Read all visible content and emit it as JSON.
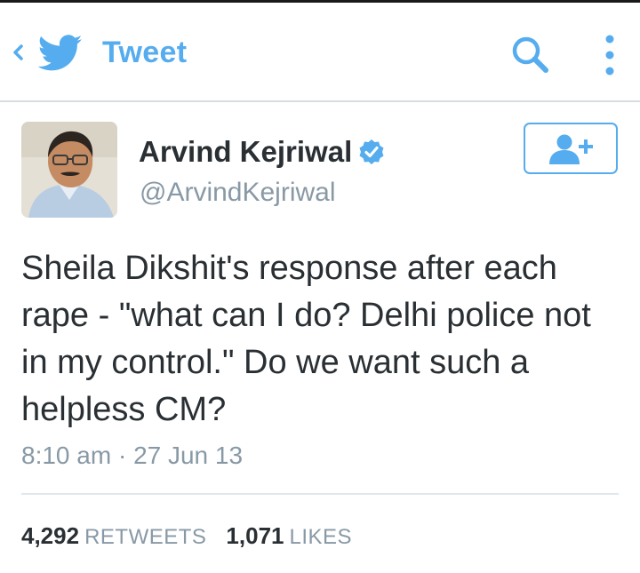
{
  "header": {
    "title": "Tweet"
  },
  "author": {
    "name": "Arvind Kejriwal",
    "handle": "@ArvindKejriwal"
  },
  "tweet": {
    "text": "Sheila Dikshit's response after each rape - \"what can I do? Delhi police not in my control.\" Do we want such a helpless CM?",
    "time": "8:10 am",
    "separator": "·",
    "date": "27 Jun 13"
  },
  "stats": {
    "retweets_count": "4,292",
    "retweets_label": "RETWEETS",
    "likes_count": "1,071",
    "likes_label": "LIKES"
  },
  "colors": {
    "accent": "#55acee",
    "text": "#292f33",
    "muted": "#8899a6"
  },
  "icons": [
    "back-icon",
    "twitter-bird-icon",
    "search-icon",
    "more-vertical-icon",
    "verified-icon",
    "follow-user-icon"
  ]
}
